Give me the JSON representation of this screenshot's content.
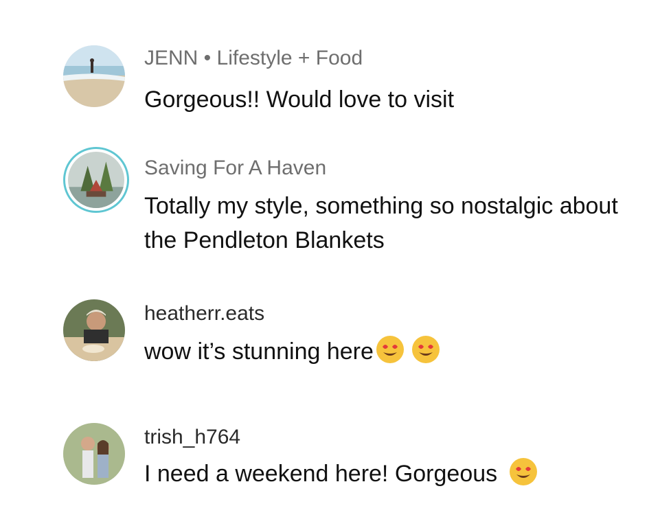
{
  "comments": [
    {
      "username": "JENN • Lifestyle + Food",
      "text": "Gorgeous!! Would love to visit",
      "avatar_icon": "beach-photo",
      "emojis": []
    },
    {
      "username": "Saving For A Haven",
      "text": "Totally my style, something so nostalgic about the Pendleton Blankets",
      "avatar_icon": "cabin-photo",
      "has_story_ring": true,
      "ring_color": "#5fc6d2",
      "emojis": []
    },
    {
      "username": "heatherr.eats",
      "text": "wow it’s stunning here",
      "avatar_icon": "eating-photo",
      "emojis": [
        "heart-eyes",
        "heart-eyes"
      ]
    },
    {
      "username": "trish_h764",
      "text": "I need a weekend here! Gorgeous",
      "avatar_icon": "couple-photo",
      "emojis": [
        "heart-eyes"
      ]
    }
  ]
}
